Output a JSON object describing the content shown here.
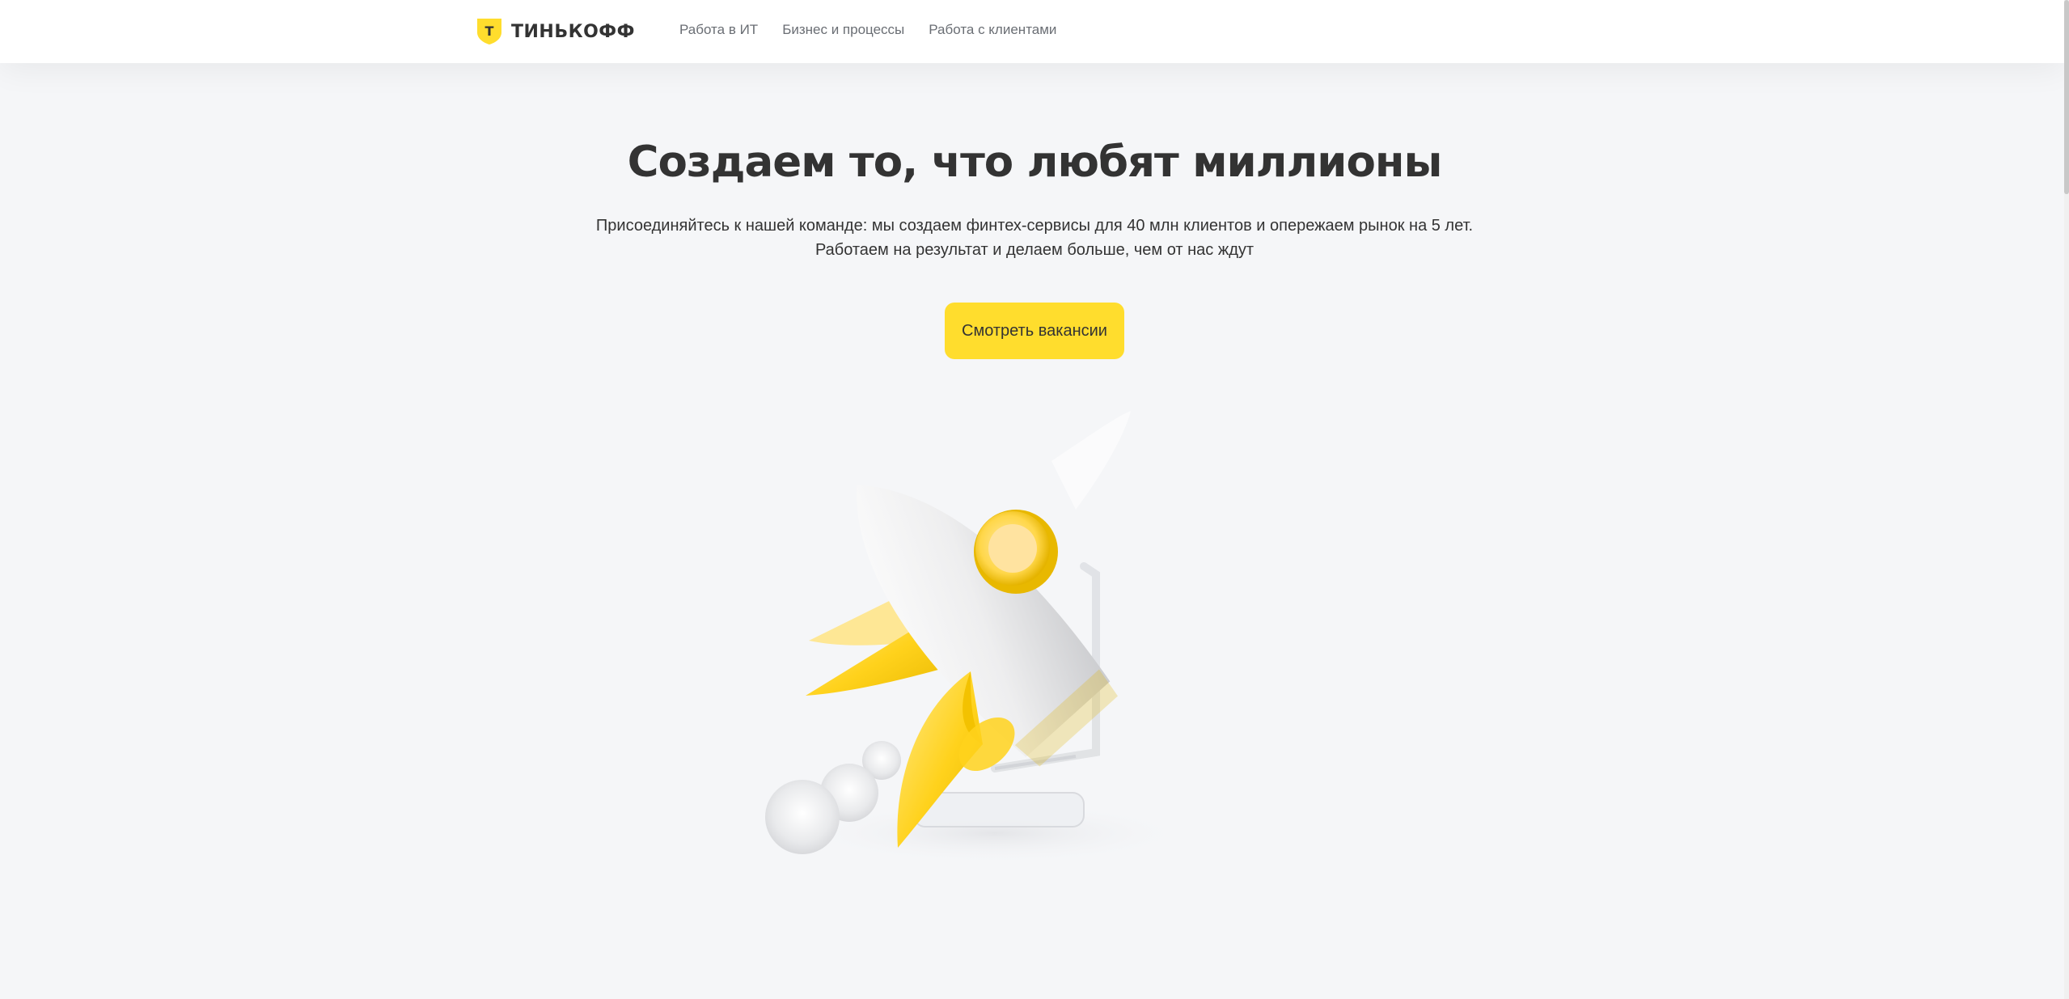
{
  "header": {
    "logo_text": "ТИНЬКОФФ",
    "logo_letter": "Т",
    "nav": [
      {
        "label": "Работа в ИТ"
      },
      {
        "label": "Бизнес и процессы"
      },
      {
        "label": "Работа с клиентами"
      }
    ]
  },
  "hero": {
    "title": "Создаем то, что любят миллионы",
    "subtitle_line1": "Присоединяйтесь к нашей команде: мы создаем финтех-сервисы для 40 млн клиентов и опережаем рынок на 5 лет.",
    "subtitle_line2": "Работаем на результат и делаем больше, чем от нас ждут",
    "cta_label": "Смотреть вакансии",
    "illustration": "rocket-illustration"
  },
  "colors": {
    "accent": "#ffdd2d",
    "background": "#f5f6f8",
    "text": "#333333",
    "nav_text": "#6a6e74"
  }
}
